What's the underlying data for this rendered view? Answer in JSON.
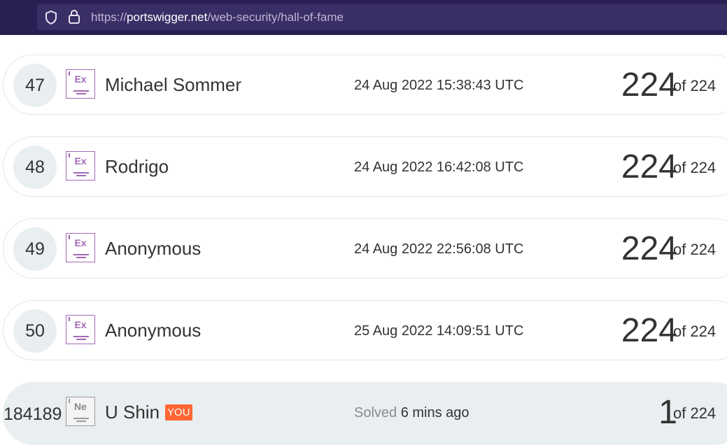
{
  "browser": {
    "url_prefix": "https://",
    "url_domain": "portswigger.net",
    "url_path": "/web-security/hall-of-fame"
  },
  "rows": [
    {
      "rank": "47",
      "level": "Ex",
      "name": "Michael Sommer",
      "date": "24 Aug 2022 15:38:43 UTC",
      "score": "224",
      "total": "of 224"
    },
    {
      "rank": "48",
      "level": "Ex",
      "name": "Rodrigo",
      "date": "24 Aug 2022 16:42:08 UTC",
      "score": "224",
      "total": "of 224"
    },
    {
      "rank": "49",
      "level": "Ex",
      "name": "Anonymous",
      "date": "24 Aug 2022 22:56:08 UTC",
      "score": "224",
      "total": "of 224"
    },
    {
      "rank": "50",
      "level": "Ex",
      "name": "Anonymous",
      "date": "25 Aug 2022 14:09:51 UTC",
      "score": "224",
      "total": "of 224"
    }
  ],
  "you": {
    "rank": "184189",
    "level": "Ne",
    "name": "U Shin",
    "tag": "YOU",
    "solved_label": "Solved",
    "solved_time": "6 mins ago",
    "score": "1",
    "total": "of 224"
  },
  "icons": {
    "shield": "shield-icon",
    "lock": "lock-icon",
    "badge": "level-badge-icon"
  },
  "colors": {
    "topbar": "#2a1f52",
    "expert_badge": "#a468b6",
    "you_tag": "#ff6633",
    "you_row": "#e9eef0"
  }
}
